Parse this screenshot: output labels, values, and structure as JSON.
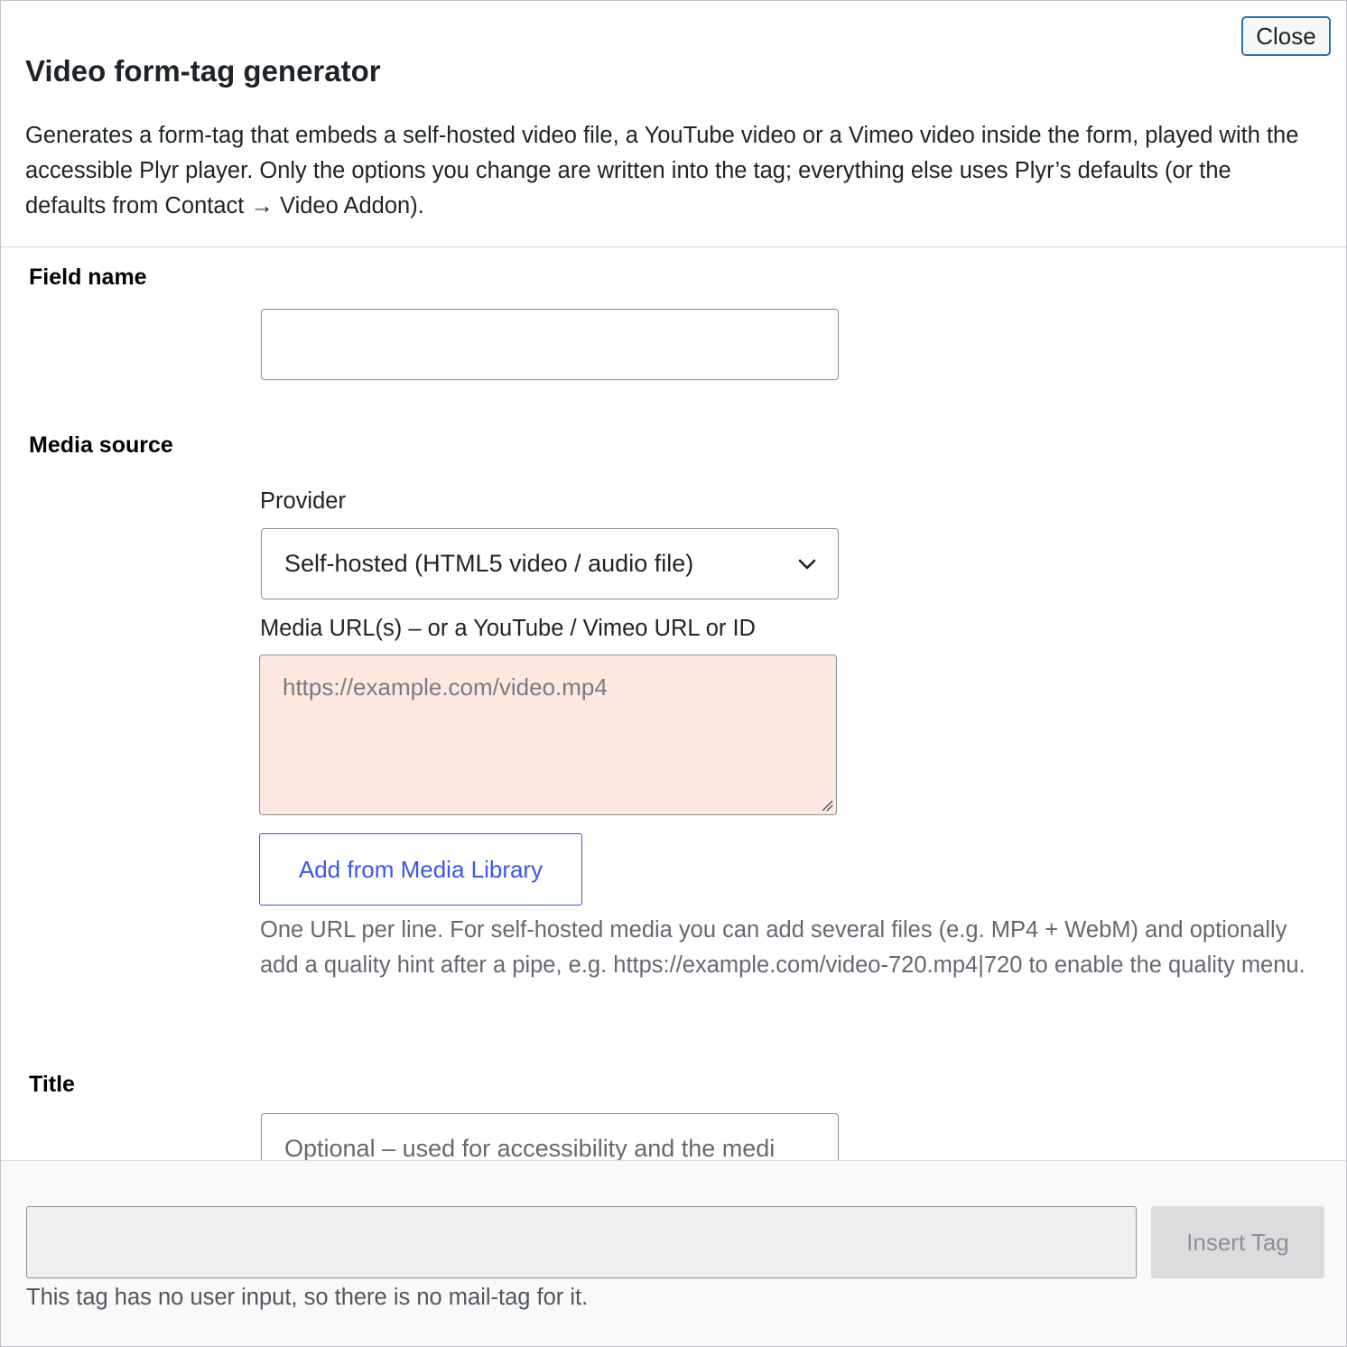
{
  "dialog": {
    "close_label": "Close",
    "title": "Video form-tag generator",
    "description": "Generates a form-tag that embeds a self-hosted video file, a YouTube video or a Vimeo video inside the form, played with the accessible Plyr player. Only the options you change are written into the tag; everything else uses Plyr’s defaults (or the defaults from Contact → Video Addon)."
  },
  "field_name": {
    "label": "Field name",
    "value": "",
    "placeholder": ""
  },
  "media_source": {
    "label": "Media source",
    "provider_label": "Provider",
    "provider_value": "Self-hosted (HTML5 video / audio file)",
    "url_label": "Media URL(s) – or a YouTube / Vimeo URL or ID",
    "url_placeholder": "https://example.com/video.mp4",
    "url_highlight_color": "#fde9df",
    "add_button_label": "Add from Media Library",
    "help_text": "One URL per line. For self-hosted media you can add several files (e.g. MP4 + WebM) and optionally add a quality hint after a pipe, e.g. https://example.com/video-720.mp4|720 to enable the quality menu."
  },
  "title_field": {
    "label": "Title",
    "placeholder": "Optional – used for accessibility and the medi"
  },
  "footer": {
    "tag_value": "",
    "insert_label": "Insert Tag",
    "note": "This tag has no user input, so there is no mail-tag for it."
  },
  "colors": {
    "accent": "#2271b1",
    "link_blue": "#3858e9",
    "disabled_button": "#dcdcde"
  }
}
